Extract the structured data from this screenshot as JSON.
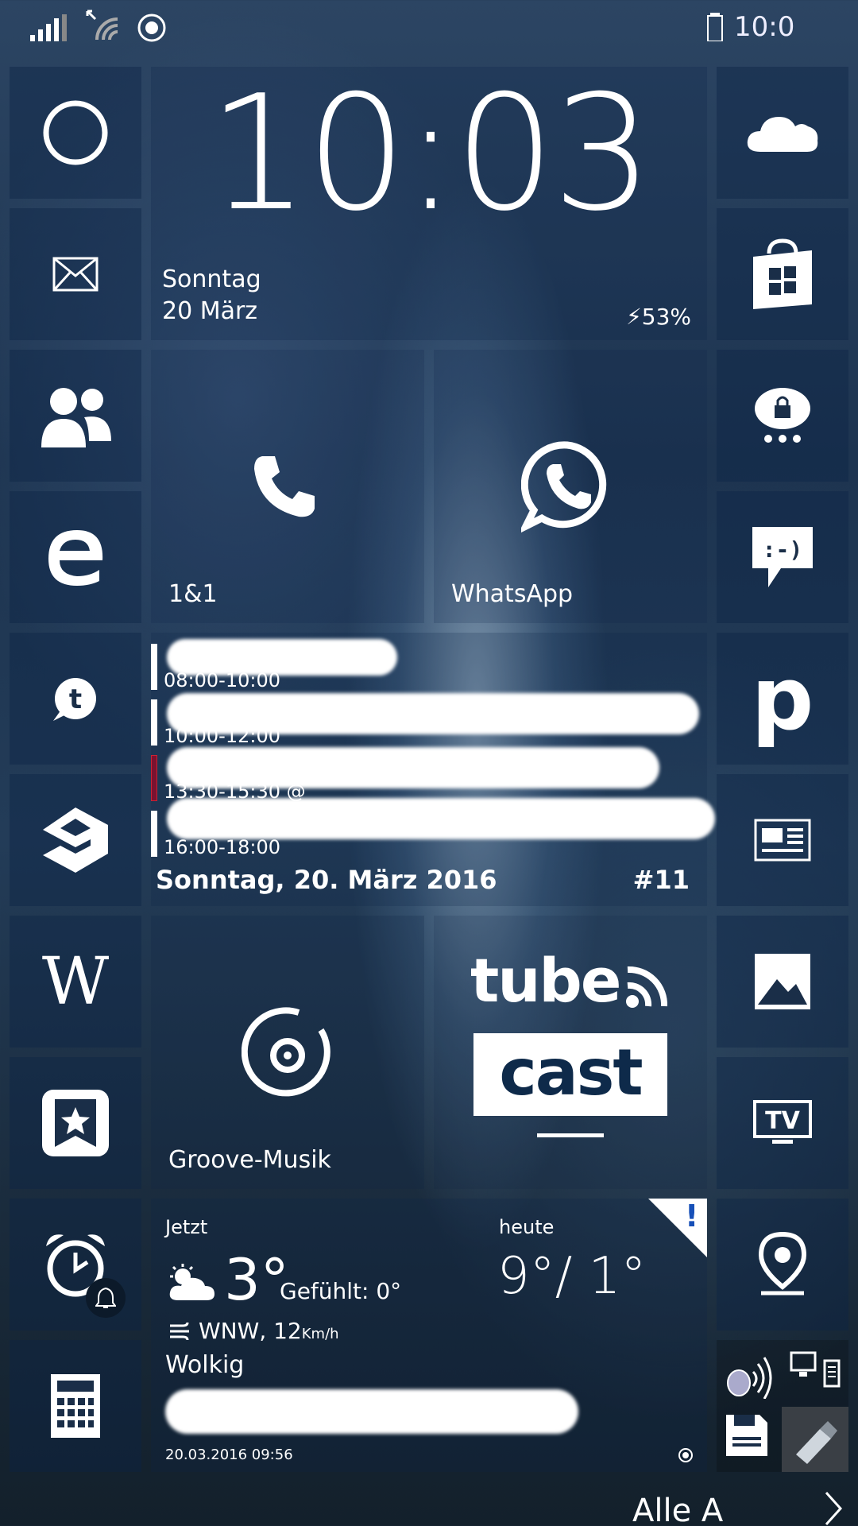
{
  "status_bar": {
    "icons": [
      "signal-bars-icon",
      "wifi-icon",
      "location-icon",
      "battery-icon"
    ],
    "clock": "10:0"
  },
  "clock_tile": {
    "time": "10:03",
    "weekday": "Sonntag",
    "date": "20 März",
    "battery": "⚡53%"
  },
  "left_column": [
    "cortana-icon",
    "mail-icon",
    "people-icon",
    "edge-icon",
    "tumblr-icon",
    "9gag-icon",
    "wikipedia-icon",
    "bookmark-star-icon",
    "alarm-icon",
    "calculator-icon"
  ],
  "right_column": [
    "onedrive-icon",
    "store-icon",
    "chat-lock-icon",
    "messaging-icon",
    "p-app-icon",
    "news-icon",
    "photos-icon",
    "tv-icon",
    "maps-pin-icon",
    "sound-devices-icon"
  ],
  "tiles": {
    "phone_label": "1&1",
    "whatsapp_label": "WhatsApp",
    "groove_label": "Groove-Musik",
    "tubecast_top": "tube",
    "tubecast_bottom": "cast"
  },
  "calendar": {
    "events": [
      {
        "time": "08:00-10:00",
        "color": "#ffffff"
      },
      {
        "time": "10:00-12:00",
        "color": "#ffffff"
      },
      {
        "time": "13:30-15:30 @",
        "color": "#7a1230"
      },
      {
        "time": "16:00-18:00",
        "color": "#ffffff"
      }
    ],
    "footer_date": "Sonntag, 20. März 2016",
    "footer_week": "#11"
  },
  "weather": {
    "now_label": "Jetzt",
    "now_temp": "3°",
    "felt": "Gefühlt: 0°",
    "wind_dir": "WNW, 12",
    "wind_unit": "Km/h",
    "condition": "Wolkig",
    "today_label": "heute",
    "today_range": "9°/ 1°",
    "alert": "!",
    "updated": "20.03.2016 09:56"
  },
  "alarm_badge_icon": "bell-icon",
  "bottom_bar": {
    "all_apps": "Alle A",
    "chevron_icon": "chevron-right-icon"
  }
}
